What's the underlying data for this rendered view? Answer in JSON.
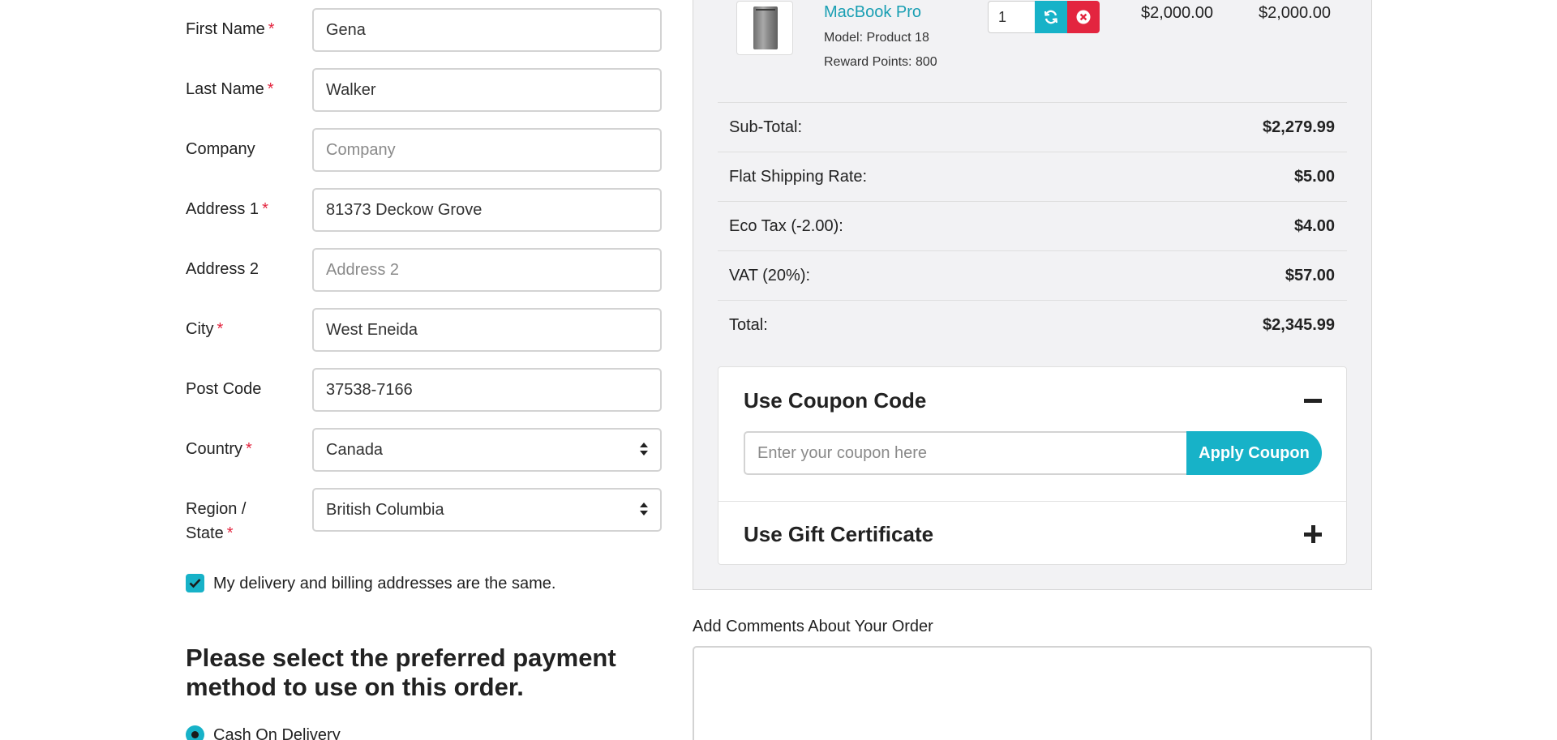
{
  "form": {
    "first_name": {
      "label": "First Name",
      "required": "*",
      "value": "Gena"
    },
    "last_name": {
      "label": "Last Name",
      "required": "*",
      "value": "Walker"
    },
    "company": {
      "label": "Company",
      "placeholder": "Company"
    },
    "address_1": {
      "label": "Address 1",
      "required": "*",
      "value": "81373 Deckow Grove"
    },
    "address_2": {
      "label": "Address 2",
      "placeholder": "Address 2"
    },
    "city": {
      "label": "City",
      "required": "*",
      "value": "West Eneida"
    },
    "post_code": {
      "label": "Post Code",
      "value": "37538-7166"
    },
    "country": {
      "label": "Country",
      "required": "*",
      "value": "Canada"
    },
    "region": {
      "label_line1": "Region /",
      "label_line2": "State",
      "required": "*",
      "value": "British Columbia"
    },
    "same_address_label": "My delivery and billing addresses are the same.",
    "same_address_checked": true
  },
  "payment": {
    "title": "Please select the preferred payment method to use on this order.",
    "option_cod": "Cash On Delivery"
  },
  "cart": {
    "product": {
      "name": "MacBook Pro",
      "model": "Model: Product 18",
      "reward_points": "Reward Points: 800",
      "quantity": "1",
      "unit_price": "$2,000.00",
      "total": "$2,000.00"
    },
    "totals": [
      {
        "label": "Sub-Total:",
        "value": "$2,279.99"
      },
      {
        "label": "Flat Shipping Rate:",
        "value": "$5.00"
      },
      {
        "label": "Eco Tax (-2.00):",
        "value": "$4.00"
      },
      {
        "label": "VAT (20%):",
        "value": "$57.00"
      },
      {
        "label": "Total:",
        "value": "$2,345.99"
      }
    ]
  },
  "coupon": {
    "title": "Use Coupon Code",
    "placeholder": "Enter your coupon here",
    "button": "Apply Coupon"
  },
  "gift": {
    "title": "Use Gift Certificate"
  },
  "comments": {
    "label": "Add Comments About Your Order"
  },
  "colors": {
    "accent": "#17b2c8",
    "danger": "#e3253f",
    "link": "#1a9fb3"
  }
}
